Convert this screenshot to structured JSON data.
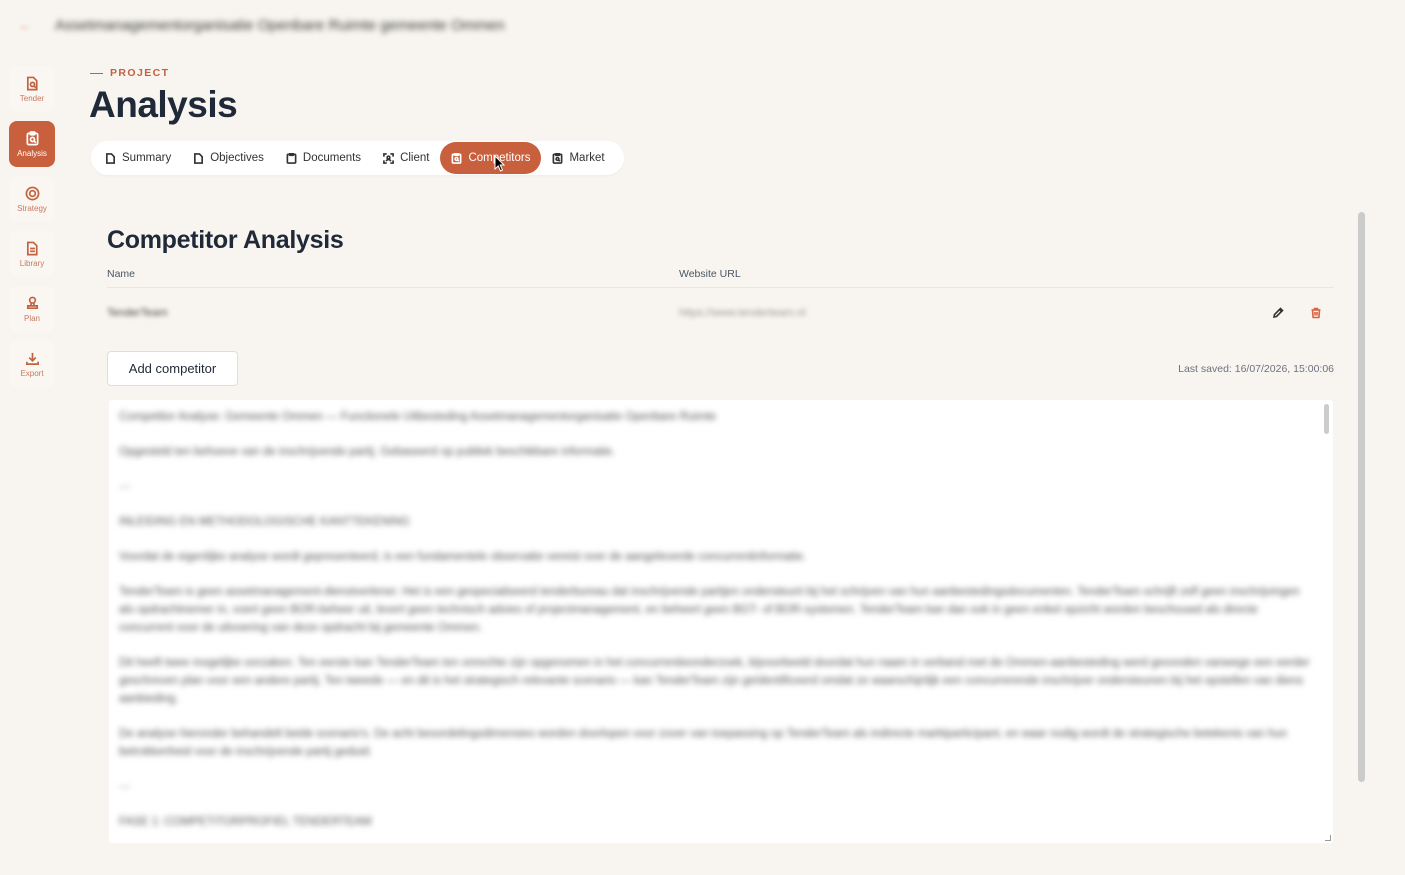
{
  "topbar": {
    "back_icon": "arrow-left-icon",
    "breadcrumb": "Assetmanagementorganisatie Openbare Ruimte gemeente Ommen"
  },
  "sidebar": {
    "items": [
      {
        "label": "Tender",
        "icon": "file-search-icon",
        "active": false
      },
      {
        "label": "Analysis",
        "icon": "clipboard-search-icon",
        "active": true
      },
      {
        "label": "Strategy",
        "icon": "target-icon",
        "active": false
      },
      {
        "label": "Library",
        "icon": "document-icon",
        "active": false
      },
      {
        "label": "Plan",
        "icon": "stamp-icon",
        "active": false
      },
      {
        "label": "Export",
        "icon": "download-icon",
        "active": false
      }
    ]
  },
  "header": {
    "eyebrow": "PROJECT",
    "title": "Analysis"
  },
  "tabs": [
    {
      "label": "Summary",
      "icon": "file-icon",
      "active": false
    },
    {
      "label": "Objectives",
      "icon": "file-icon",
      "active": false
    },
    {
      "label": "Documents",
      "icon": "clipboard-icon",
      "active": false
    },
    {
      "label": "Client",
      "icon": "scan-user-icon",
      "active": false
    },
    {
      "label": "Competitors",
      "icon": "clipboard-search-icon",
      "active": true
    },
    {
      "label": "Market",
      "icon": "clipboard-search-icon",
      "active": false
    }
  ],
  "competitors": {
    "title": "Competitor Analysis",
    "columns": {
      "name": "Name",
      "url": "Website URL"
    },
    "rows": [
      {
        "name": "TenderTeam",
        "url": "https://www.tenderteam.nl"
      }
    ],
    "add_label": "Add competitor",
    "last_saved": "Last saved: 16/07/2026, 15:00:06"
  },
  "editor": {
    "paragraphs": [
      "Competitor Analyse: Gemeente Ommen — Functionele Uitbesteding Assetmanagementorganisatie Openbare Ruimte",
      "Opgesteld ten behoeve van de inschrijvende partij. Gebaseerd op publiek beschikbare informatie.",
      "---",
      "INLEIDING EN METHODOLOGISCHE KANTTEKENING",
      "Voordat de eigenlijke analyse wordt gepresenteerd, is een fundamentele observatie vereist over de aangeleverde concurrentinformatie.",
      "TenderTeam is geen assetmanagement-dienstverlener. Het is een gespecialiseerd tenderbureau dat inschrijvende partijen ondersteunt bij het schrijven van hun aanbestedingsdocumenten. TenderTeam schrijft zelf geen inschrijvingen als opdrachtnemer in, voert geen BOR-beheer uit, levert geen technisch advies of projectmanagement, en beheert geen BGT- of BOR-systemen. TenderTeam kan dan ook in geen enkel opzicht worden beschouwd als directe concurrent voor de uitvoering van deze opdracht bij gemeente Ommen.",
      "Dit heeft twee mogelijke oorzaken. Ten eerste kan TenderTeam ten onrechte zijn opgenomen in het concurrentieonderzoek, bijvoorbeeld doordat hun naam in verband met de Ommen-aanbesteding werd gevonden vanwege een eerder geschreven plan voor een andere partij. Ten tweede — en dit is het strategisch relevante scenario — kan TenderTeam zijn geïdentificeerd omdat ze waarschijnlijk een concurrerende inschrijver ondersteunen bij het opstellen van diens aanbieding.",
      "De analyse hieronder behandelt beide scenario's. De acht beoordelingsdimensies worden doorlopen voor zover van toepassing op TenderTeam als indirecte marktparticipant, en waar nodig wordt de strategische betekenis van hun betrokkenheid voor de inschrijvende partij geduid.",
      "---",
      "FASE 1: COMPETITORPROFIEL TENDERTEAM"
    ]
  }
}
